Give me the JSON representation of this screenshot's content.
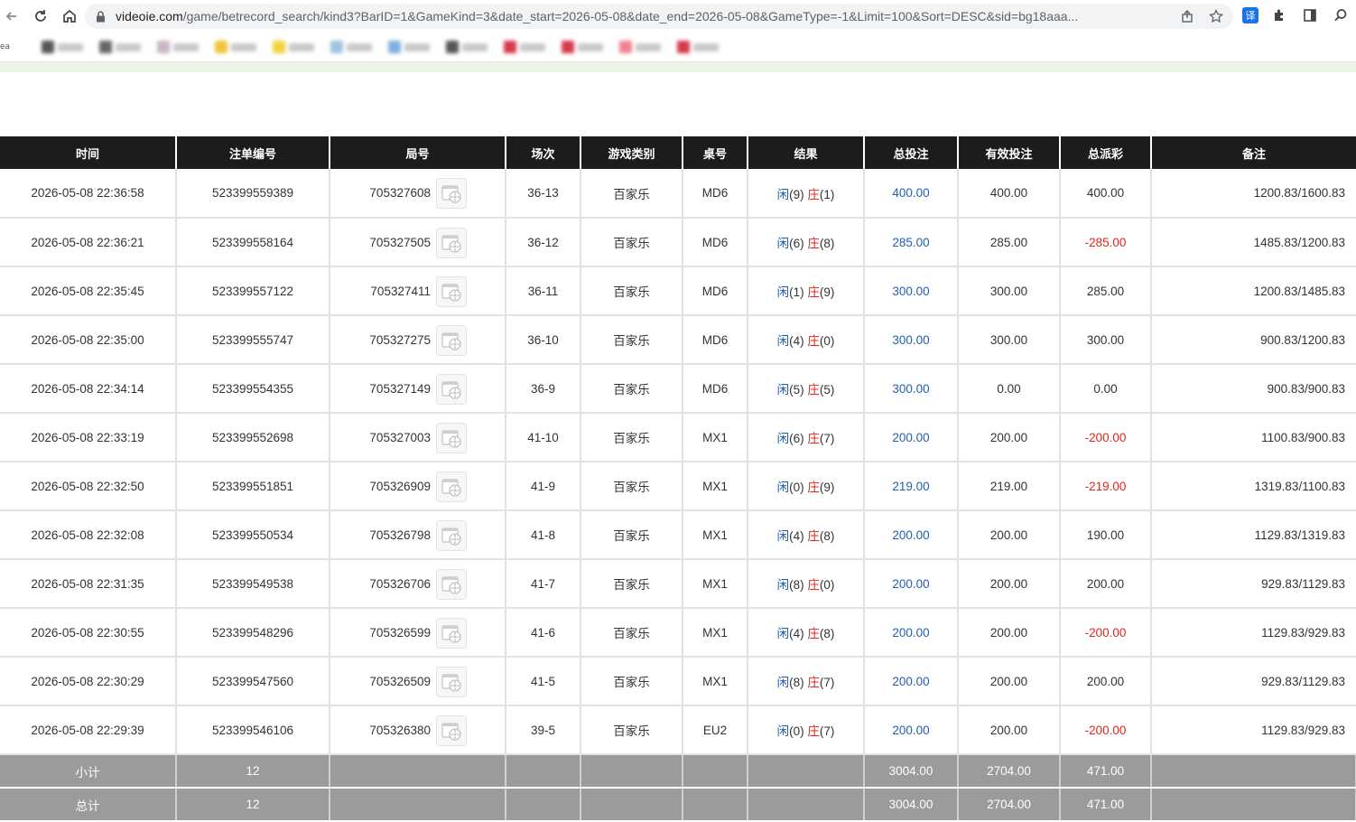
{
  "browser": {
    "url_host": "videoie.com",
    "url_path": "/game/betrecord_search/kind3?BarID=1&GameKind=3&date_start=2026-05-08&date_end=2026-05-08&GameType=-1&Limit=100&Sort=DESC&sid=bg18aaa...",
    "bookmark_clip_label": "ea",
    "translate_ext_label": "译"
  },
  "table": {
    "headers": [
      "时间",
      "注单编号",
      "局号",
      "场次",
      "游戏类别",
      "桌号",
      "结果",
      "总投注",
      "有效投注",
      "总派彩",
      "备注"
    ],
    "rows": [
      {
        "time": "2026-05-08 22:36:58",
        "bet_id": "523399559389",
        "round_id": "705327608",
        "session": "36-13",
        "game": "百家乐",
        "table": "MD6",
        "player_label": "闲",
        "player_val": "(9)",
        "banker_label": "庄",
        "banker_val": "(1)",
        "total_bet": "400.00",
        "valid_bet": "400.00",
        "payout": "400.00",
        "payout_neg": false,
        "note": "1200.83/1600.83"
      },
      {
        "time": "2026-05-08 22:36:21",
        "bet_id": "523399558164",
        "round_id": "705327505",
        "session": "36-12",
        "game": "百家乐",
        "table": "MD6",
        "player_label": "闲",
        "player_val": "(6)",
        "banker_label": "庄",
        "banker_val": "(8)",
        "total_bet": "285.00",
        "valid_bet": "285.00",
        "payout": "-285.00",
        "payout_neg": true,
        "note": "1485.83/1200.83"
      },
      {
        "time": "2026-05-08 22:35:45",
        "bet_id": "523399557122",
        "round_id": "705327411",
        "session": "36-11",
        "game": "百家乐",
        "table": "MD6",
        "player_label": "闲",
        "player_val": "(1)",
        "banker_label": "庄",
        "banker_val": "(9)",
        "total_bet": "300.00",
        "valid_bet": "300.00",
        "payout": "285.00",
        "payout_neg": false,
        "note": "1200.83/1485.83"
      },
      {
        "time": "2026-05-08 22:35:00",
        "bet_id": "523399555747",
        "round_id": "705327275",
        "session": "36-10",
        "game": "百家乐",
        "table": "MD6",
        "player_label": "闲",
        "player_val": "(4)",
        "banker_label": "庄",
        "banker_val": "(0)",
        "total_bet": "300.00",
        "valid_bet": "300.00",
        "payout": "300.00",
        "payout_neg": false,
        "note": "900.83/1200.83"
      },
      {
        "time": "2026-05-08 22:34:14",
        "bet_id": "523399554355",
        "round_id": "705327149",
        "session": "36-9",
        "game": "百家乐",
        "table": "MD6",
        "player_label": "闲",
        "player_val": "(5)",
        "banker_label": "庄",
        "banker_val": "(5)",
        "total_bet": "300.00",
        "valid_bet": "0.00",
        "payout": "0.00",
        "payout_neg": false,
        "note": "900.83/900.83"
      },
      {
        "time": "2026-05-08 22:33:19",
        "bet_id": "523399552698",
        "round_id": "705327003",
        "session": "41-10",
        "game": "百家乐",
        "table": "MX1",
        "player_label": "闲",
        "player_val": "(6)",
        "banker_label": "庄",
        "banker_val": "(7)",
        "total_bet": "200.00",
        "valid_bet": "200.00",
        "payout": "-200.00",
        "payout_neg": true,
        "note": "1100.83/900.83"
      },
      {
        "time": "2026-05-08 22:32:50",
        "bet_id": "523399551851",
        "round_id": "705326909",
        "session": "41-9",
        "game": "百家乐",
        "table": "MX1",
        "player_label": "闲",
        "player_val": "(0)",
        "banker_label": "庄",
        "banker_val": "(9)",
        "total_bet": "219.00",
        "valid_bet": "219.00",
        "payout": "-219.00",
        "payout_neg": true,
        "note": "1319.83/1100.83"
      },
      {
        "time": "2026-05-08 22:32:08",
        "bet_id": "523399550534",
        "round_id": "705326798",
        "session": "41-8",
        "game": "百家乐",
        "table": "MX1",
        "player_label": "闲",
        "player_val": "(4)",
        "banker_label": "庄",
        "banker_val": "(8)",
        "total_bet": "200.00",
        "valid_bet": "200.00",
        "payout": "190.00",
        "payout_neg": false,
        "note": "1129.83/1319.83"
      },
      {
        "time": "2026-05-08 22:31:35",
        "bet_id": "523399549538",
        "round_id": "705326706",
        "session": "41-7",
        "game": "百家乐",
        "table": "MX1",
        "player_label": "闲",
        "player_val": "(8)",
        "banker_label": "庄",
        "banker_val": "(0)",
        "total_bet": "200.00",
        "valid_bet": "200.00",
        "payout": "200.00",
        "payout_neg": false,
        "note": "929.83/1129.83"
      },
      {
        "time": "2026-05-08 22:30:55",
        "bet_id": "523399548296",
        "round_id": "705326599",
        "session": "41-6",
        "game": "百家乐",
        "table": "MX1",
        "player_label": "闲",
        "player_val": "(4)",
        "banker_label": "庄",
        "banker_val": "(8)",
        "total_bet": "200.00",
        "valid_bet": "200.00",
        "payout": "-200.00",
        "payout_neg": true,
        "note": "1129.83/929.83"
      },
      {
        "time": "2026-05-08 22:30:29",
        "bet_id": "523399547560",
        "round_id": "705326509",
        "session": "41-5",
        "game": "百家乐",
        "table": "MX1",
        "player_label": "闲",
        "player_val": "(8)",
        "banker_label": "庄",
        "banker_val": "(7)",
        "total_bet": "200.00",
        "valid_bet": "200.00",
        "payout": "200.00",
        "payout_neg": false,
        "note": "929.83/1129.83"
      },
      {
        "time": "2026-05-08 22:29:39",
        "bet_id": "523399546106",
        "round_id": "705326380",
        "session": "39-5",
        "game": "百家乐",
        "table": "EU2",
        "player_label": "闲",
        "player_val": "(0)",
        "banker_label": "庄",
        "banker_val": "(7)",
        "total_bet": "200.00",
        "valid_bet": "200.00",
        "payout": "-200.00",
        "payout_neg": true,
        "note": "1129.83/929.83"
      }
    ],
    "subtotal": {
      "label": "小计",
      "count": "12",
      "total_bet": "3004.00",
      "valid_bet": "2704.00",
      "payout": "471.00"
    },
    "total": {
      "label": "总计",
      "count": "12",
      "total_bet": "3004.00",
      "valid_bet": "2704.00",
      "payout": "471.00"
    }
  },
  "colors": {
    "header_bg": "#1c1c1c",
    "bet_blue": "#1f5fb5",
    "neg_red": "#e0261b",
    "summary_bg": "#9b9b9b"
  },
  "icons": [
    "back-arrow-icon",
    "reload-icon",
    "home-icon",
    "lock-icon",
    "share-icon",
    "star-icon",
    "translate-icon",
    "puzzle-icon",
    "sidepanel-icon",
    "search-icon",
    "replay-film-icon"
  ]
}
